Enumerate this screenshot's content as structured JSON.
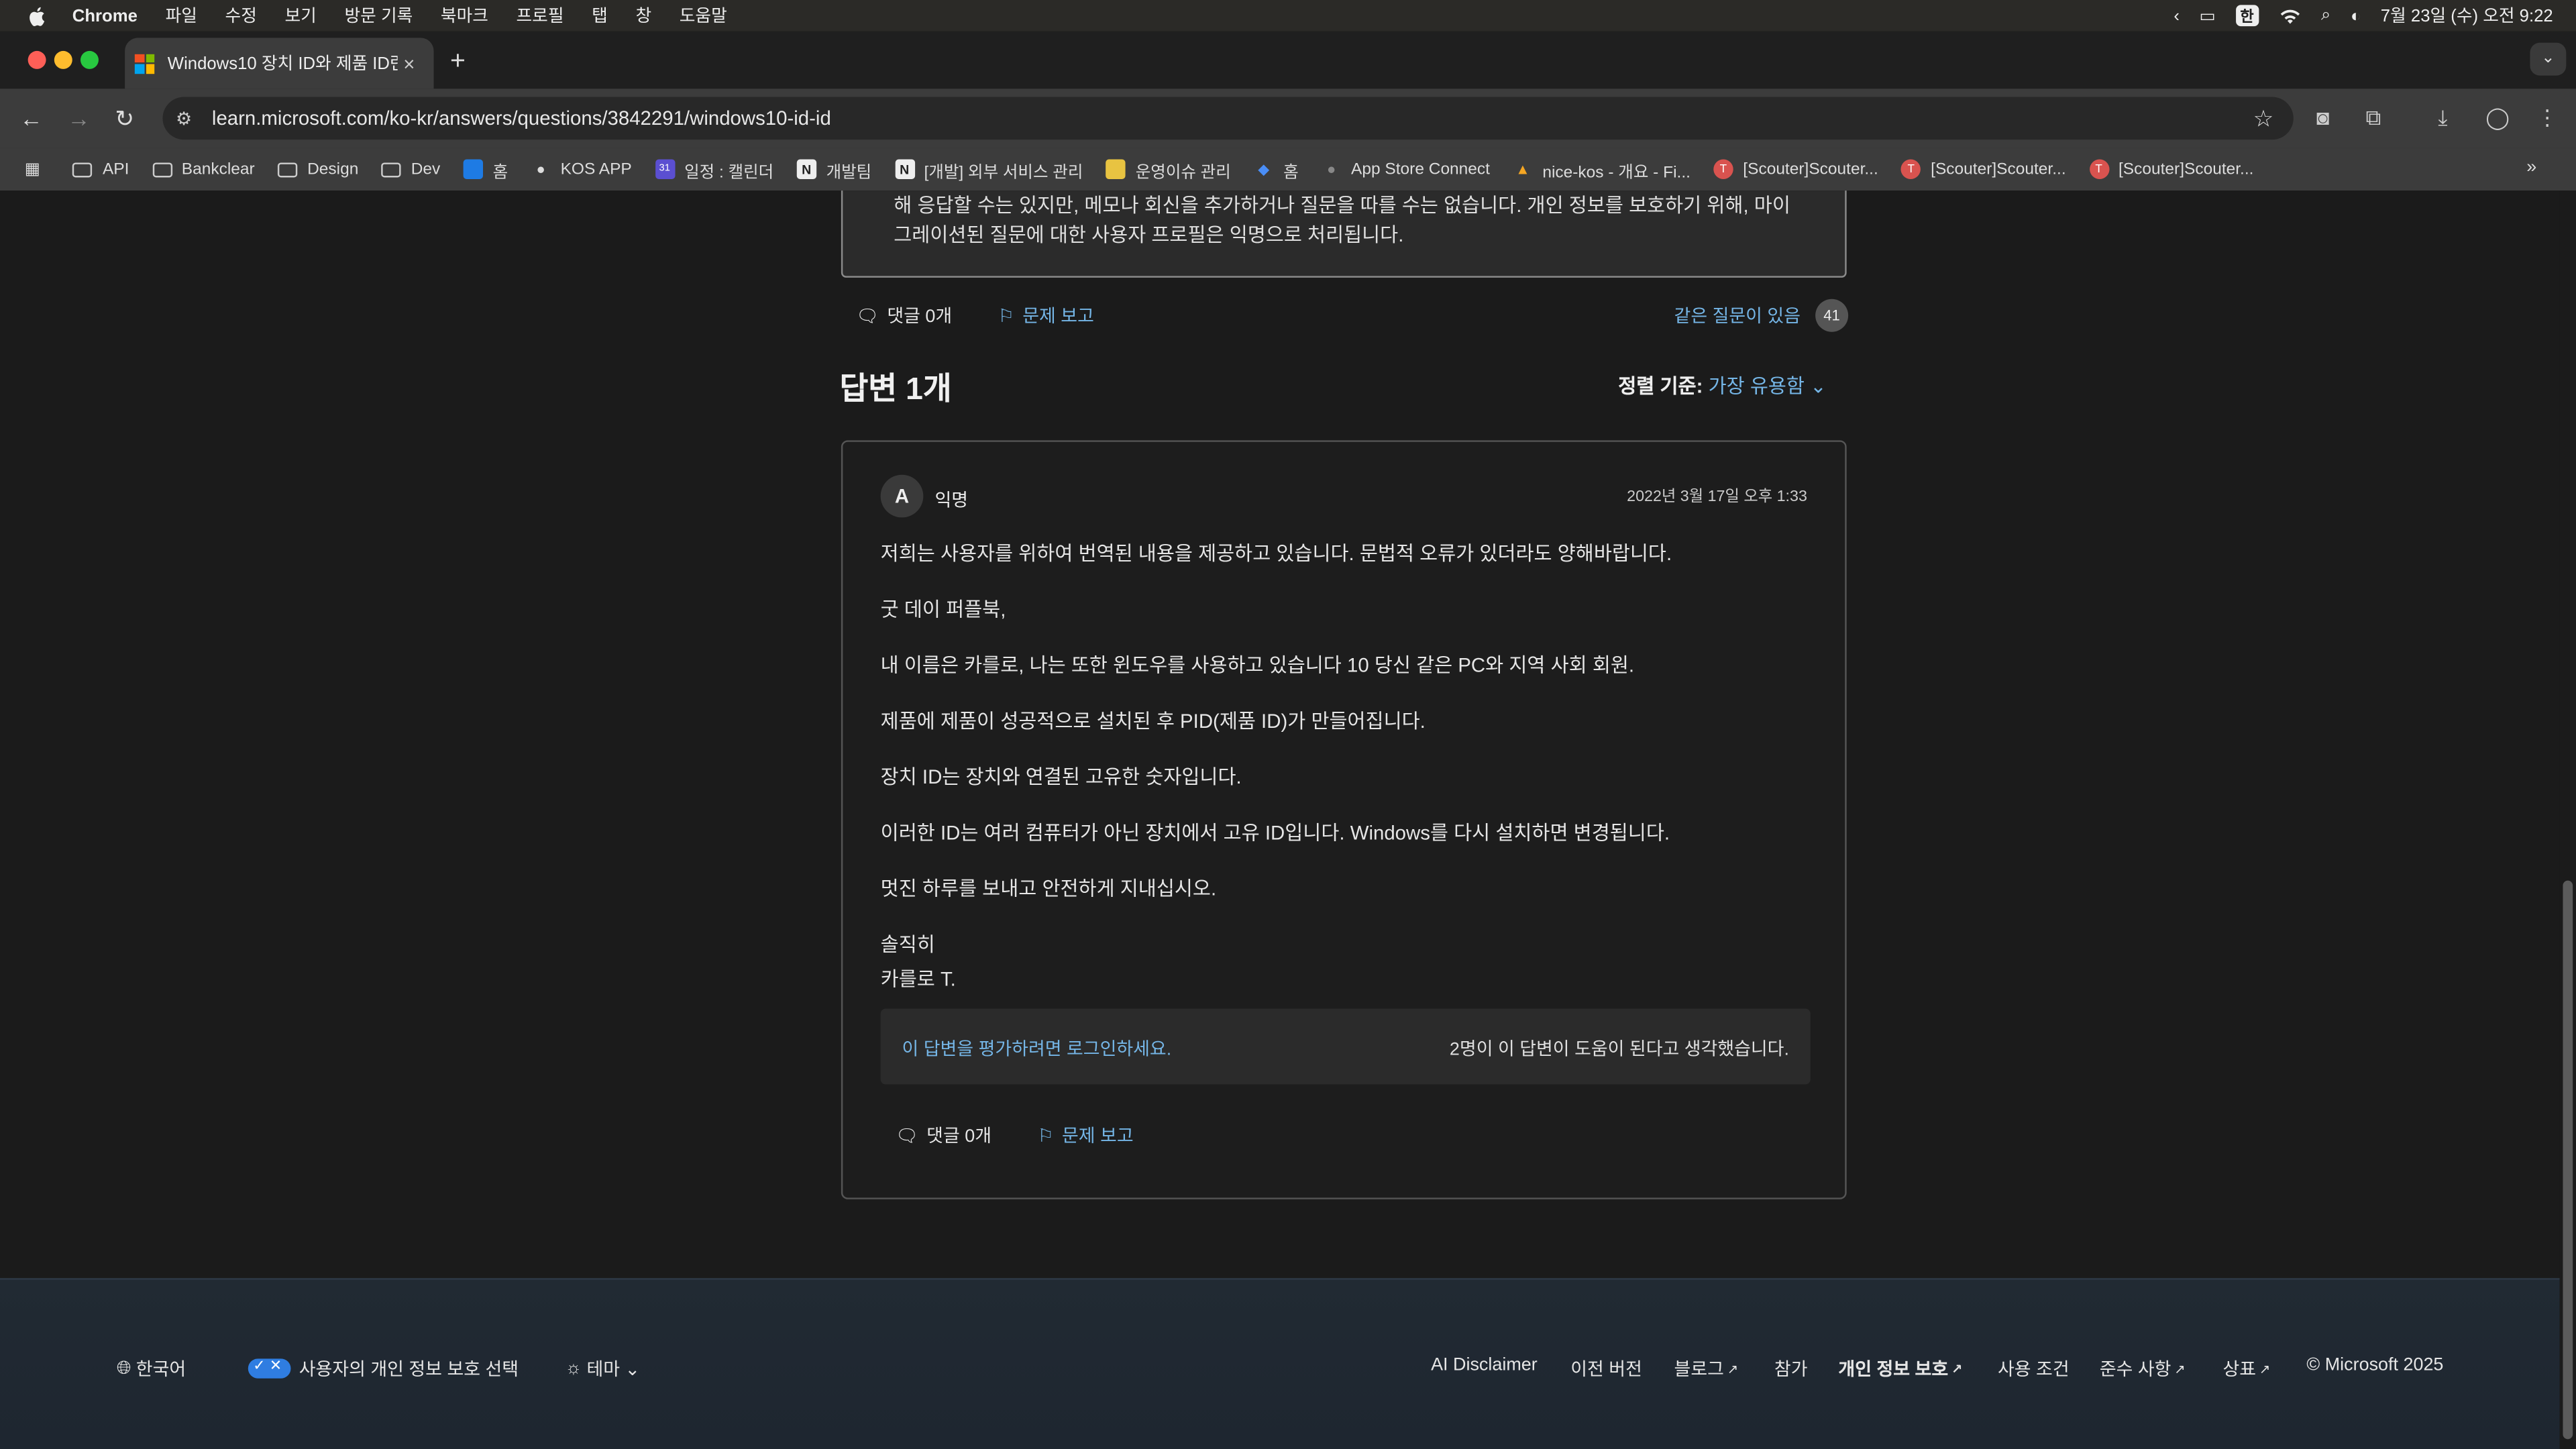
{
  "menubar": {
    "app": "Chrome",
    "items": [
      "파일",
      "수정",
      "보기",
      "방문 기록",
      "북마크",
      "프로필",
      "탭",
      "창",
      "도움말"
    ],
    "input_badge": "한",
    "clock": "7월 23일 (수) 오전 9:22"
  },
  "tab": {
    "title": "Windows10 장치 ID와 제품 ID란",
    "close": "×",
    "new_tab": "+"
  },
  "toolbar": {
    "url": "learn.microsoft.com/ko-kr/answers/questions/3842291/windows10-id-id"
  },
  "bookmarks": [
    {
      "label": "API",
      "icon": "folder-icon"
    },
    {
      "label": "Bankclear",
      "icon": "folder-icon"
    },
    {
      "label": "Design",
      "icon": "folder-icon"
    },
    {
      "label": "Dev",
      "icon": "folder-icon"
    },
    {
      "label": "홈",
      "icon": "trello-icon"
    },
    {
      "label": "KOS APP",
      "icon": "app-icon"
    },
    {
      "label": "일정 : 캘린더",
      "icon": "calendar-icon"
    },
    {
      "label": "개발팀",
      "icon": "notion-icon"
    },
    {
      "label": "[개발] 외부 서비스 관리",
      "icon": "notion-icon"
    },
    {
      "label": "운영이슈 관리",
      "icon": "sheet-icon"
    },
    {
      "label": "홈",
      "icon": "jira-icon"
    },
    {
      "label": "App Store Connect",
      "icon": "apple-icon"
    },
    {
      "label": "nice-kos - 개요 - Fi...",
      "icon": "firebase-icon"
    },
    {
      "label": "[Scouter]Scouter...",
      "icon": "scouter-icon"
    },
    {
      "label": "[Scouter]Scouter...",
      "icon": "scouter-icon"
    },
    {
      "label": "[Scouter]Scouter...",
      "icon": "scouter-icon"
    }
  ],
  "question": {
    "notice_line1": "해 응답할 수는 있지만, 메모나 회신을 추가하거나 질문을 따를 수는 없습니다. 개인 정보를 보호하기 위해, 마이",
    "notice_line2": "그레이션된 질문에 대한 사용자 프로필은 익명으로 처리됩니다.",
    "comments": "댓글 0개",
    "report": "문제 보고",
    "same_question": "같은 질문이 있음",
    "same_count": "41"
  },
  "answers": {
    "heading": "답변 1개",
    "sort_label": "정렬 기준:",
    "sort_value": "가장 유용함"
  },
  "answer": {
    "avatar": "A",
    "author": "익명",
    "date": "2022년 3월 17일 오후 1:33",
    "paragraphs": [
      "저희는 사용자를 위하여 번역된 내용을 제공하고 있습니다. 문법적 오류가 있더라도 양해바랍니다.",
      "굿 데이 퍼플북,",
      "내 이름은 카를로, 나는 또한 윈도우를 사용하고 있습니다 10 당신 같은 PC와 지역 사회 회원.",
      "제품에 제품이 성공적으로 설치된 후 PID(제품 ID)가 만들어집니다.",
      "장치 ID는 장치와 연결된 고유한 숫자입니다.",
      "이러한 ID는 여러 컴퓨터가 아닌 장치에서 고유 ID입니다. Windows를 다시 설치하면 변경됩니다.",
      "멋진 하루를 보내고 안전하게 지내십시오.",
      "솔직히",
      "카를로 T."
    ],
    "rate_prompt": "이 답변을 평가하려면 로그인하세요.",
    "helpful_text": "2명이 이 답변이 도움이 된다고 생각했습니다.",
    "comments": "댓글 0개",
    "report": "문제 보고"
  },
  "footer": {
    "language": "한국어",
    "privacy_choice": "사용자의 개인 정보 보호 선택",
    "theme": "테마",
    "links": [
      "AI Disclaimer",
      "이전 버전",
      "블로그",
      "참가",
      "개인 정보 보호",
      "사용 조건",
      "준수 사항",
      "상표"
    ],
    "copyright": "© Microsoft 2025"
  },
  "colors": {
    "link": "#75b6e7",
    "page_bg": "#1b1b1b",
    "footer_bg": "#1e2630"
  }
}
